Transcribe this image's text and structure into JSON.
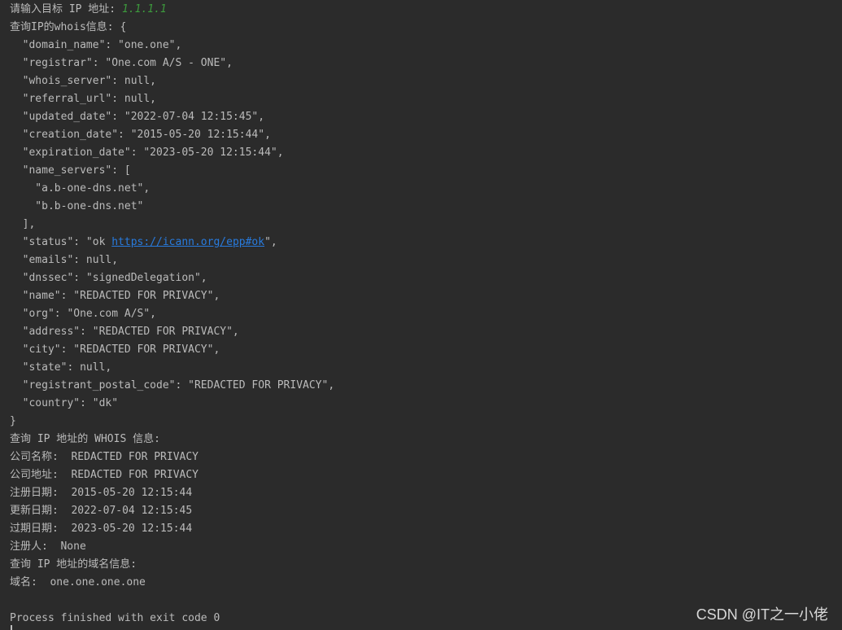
{
  "console": {
    "prompt": "请输入目标 IP 地址: ",
    "input_value": "1.1.1.1",
    "lines": [
      "查询IP的whois信息: {",
      "  \"domain_name\": \"one.one\",",
      "  \"registrar\": \"One.com A/S - ONE\",",
      "  \"whois_server\": null,",
      "  \"referral_url\": null,",
      "  \"updated_date\": \"2022-07-04 12:15:45\",",
      "  \"creation_date\": \"2015-05-20 12:15:44\",",
      "  \"expiration_date\": \"2023-05-20 12:15:44\",",
      "  \"name_servers\": [",
      "    \"a.b-one-dns.net\",",
      "    \"b.b-one-dns.net\"",
      "  ],"
    ],
    "status_prefix": "  \"status\": \"ok ",
    "status_link": "https://icann.org/epp#ok",
    "status_suffix": "\",",
    "lines_after": [
      "  \"emails\": null,",
      "  \"dnssec\": \"signedDelegation\",",
      "  \"name\": \"REDACTED FOR PRIVACY\",",
      "  \"org\": \"One.com A/S\",",
      "  \"address\": \"REDACTED FOR PRIVACY\",",
      "  \"city\": \"REDACTED FOR PRIVACY\",",
      "  \"state\": null,",
      "  \"registrant_postal_code\": \"REDACTED FOR PRIVACY\",",
      "  \"country\": \"dk\"",
      "}",
      "查询 IP 地址的 WHOIS 信息:",
      "公司名称:  REDACTED FOR PRIVACY",
      "公司地址:  REDACTED FOR PRIVACY",
      "注册日期:  2015-05-20 12:15:44",
      "更新日期:  2022-07-04 12:15:45",
      "过期日期:  2023-05-20 12:15:44",
      "注册人:  None",
      "查询 IP 地址的域名信息:",
      "域名:  one.one.one.one",
      "",
      "Process finished with exit code 0"
    ]
  },
  "watermark": "CSDN @IT之一小佬",
  "colors": {
    "background": "#2b2b2b",
    "text": "#bbbbbb",
    "user_input": "#3d9a3d",
    "link": "#287bde"
  }
}
